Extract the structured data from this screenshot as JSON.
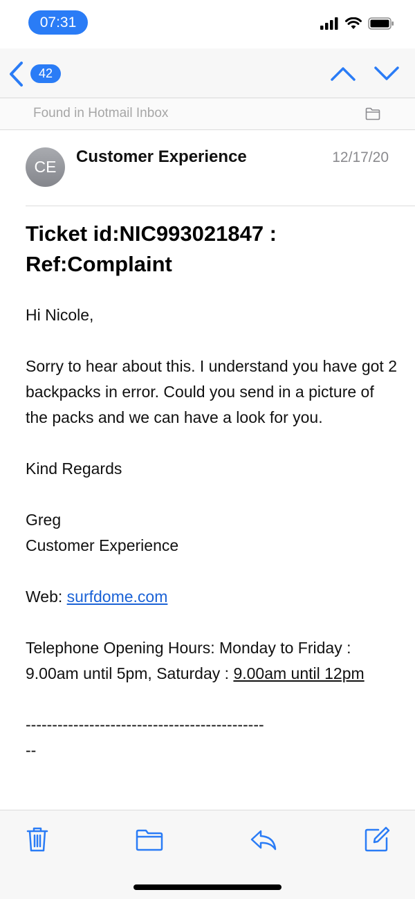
{
  "status_bar": {
    "time": "07:31"
  },
  "nav": {
    "unread_count": "42"
  },
  "found_in": "Found in Hotmail Inbox",
  "message": {
    "avatar_initials": "CE",
    "sender": "Customer Experience",
    "date": "12/17/20",
    "subject": "Ticket id:NIC993021847 : Ref:Complaint",
    "greeting": "Hi Nicole,",
    "paragraph": "Sorry to hear about this.  I understand you have got 2 backpacks in error.  Could you send in a picture of the packs and we can have a look for you.",
    "sign_off": "Kind Regards",
    "signature_name": "Greg",
    "signature_dept": "Customer Experience",
    "web_label": "Web: ",
    "web_link": "surfdome.com",
    "hours_text": "Telephone Opening Hours:  Monday to Friday : 9.00am until 5pm, Saturday : ",
    "hours_link": "9.00am until 12pm",
    "separator": "---------------------------------------------\n--"
  },
  "colors": {
    "accent": "#2a7cf6",
    "link": "#1a62d6"
  },
  "icons": [
    "back-chevron-icon",
    "up-arrow-icon",
    "down-arrow-icon",
    "folder-icon",
    "trash-icon",
    "folder-move-icon",
    "reply-icon",
    "compose-icon"
  ]
}
